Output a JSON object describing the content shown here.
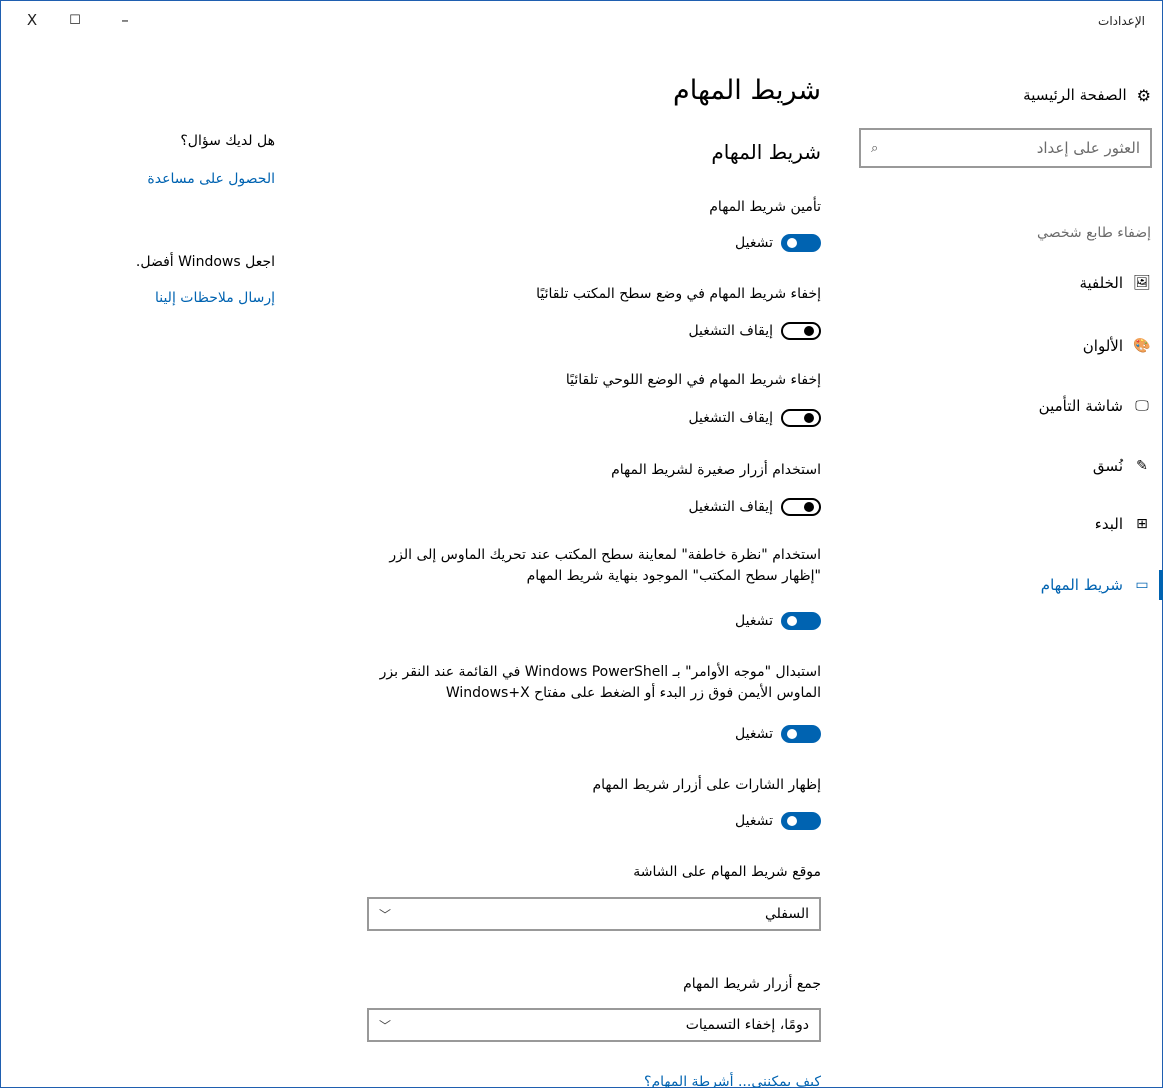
{
  "window": {
    "title": "الإعدادات",
    "close_glyph": "X",
    "maximize_glyph": "☐",
    "minimize_glyph": "–"
  },
  "sidebar": {
    "home_label": "الصفحة الرئيسية",
    "search_placeholder": "العثور على إعداد",
    "section_heading": "إضفاء طابع شخصي",
    "items": [
      {
        "label": "الخلفية",
        "icon": "image-icon",
        "glyph": "🖼"
      },
      {
        "label": "الألوان",
        "icon": "palette-icon",
        "glyph": "🎨"
      },
      {
        "label": "شاشة التأمين",
        "icon": "lock-screen-icon",
        "glyph": "🖵"
      },
      {
        "label": "نُسق",
        "icon": "themes-icon",
        "glyph": "✎"
      },
      {
        "label": "البدء",
        "icon": "start-icon",
        "glyph": "⊞"
      },
      {
        "label": "شريط المهام",
        "icon": "taskbar-icon",
        "glyph": "▭",
        "active": true
      }
    ]
  },
  "main": {
    "page_title": "شريط المهام",
    "section_title": "شريط المهام",
    "settings": [
      {
        "label": "تأمين شريط المهام",
        "state": "تشغيل",
        "on": true
      },
      {
        "label": "إخفاء شريط المهام في وضع سطح المكتب تلقائيًا",
        "state": "إيقاف التشغيل",
        "on": false
      },
      {
        "label": "إخفاء شريط المهام في الوضع اللوحي تلقائيًا",
        "state": "إيقاف التشغيل",
        "on": false
      },
      {
        "label": "استخدام أزرار صغيرة لشريط المهام",
        "state": "إيقاف التشغيل",
        "on": false
      },
      {
        "label": "استخدام \"نظرة خاطفة\" لمعاينة سطح المكتب عند تحريك الماوس إلى الزر \"إظهار سطح المكتب\" الموجود بنهاية شريط المهام",
        "state": "تشغيل",
        "on": true
      },
      {
        "label": "استبدال \"موجه الأوامر\" بـ Windows PowerShell في القائمة عند النقر بزر الماوس الأيمن فوق زر البدء أو الضغط على مفتاح Windows+X",
        "state": "تشغيل",
        "on": true
      },
      {
        "label": "إظهار الشارات على أزرار شريط المهام",
        "state": "تشغيل",
        "on": true
      }
    ],
    "location": {
      "label": "موقع شريط المهام على الشاشة",
      "value": "السفلي"
    },
    "combine": {
      "label": "جمع أزرار شريط المهام",
      "value": "دومًا، إخفاء التسميات"
    },
    "bottom_link": "كيف يمكنني... أشرطة المهام؟"
  },
  "help": {
    "question": "هل لديك سؤال؟",
    "get_help": "الحصول على مساعدة",
    "improve": "اجعل Windows أفضل.",
    "feedback": "إرسال ملاحظات إلينا"
  },
  "colors": {
    "accent": "#0063b1"
  }
}
